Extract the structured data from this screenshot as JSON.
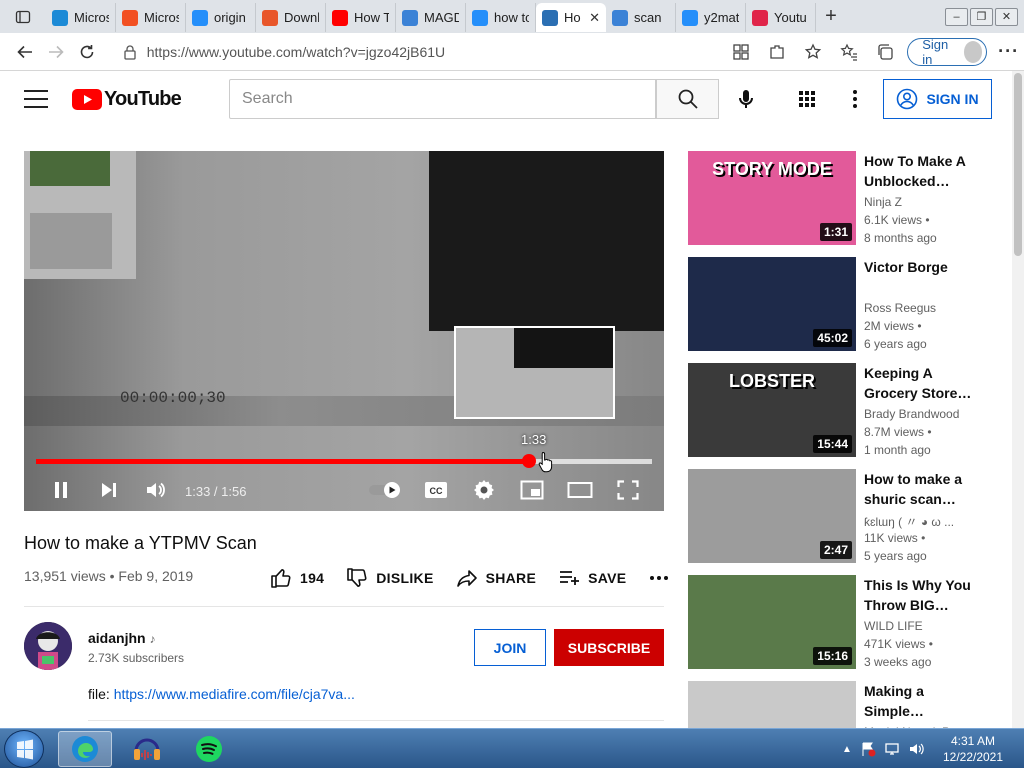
{
  "browser": {
    "tabs": [
      {
        "title": "Micros",
        "icon": "edge-icon",
        "color": "#1c8ad6"
      },
      {
        "title": "Micros",
        "icon": "microsoft-icon",
        "color": "#f25022"
      },
      {
        "title": "origin",
        "icon": "bing-icon",
        "color": "#258ffa"
      },
      {
        "title": "Downl",
        "icon": "download-site-icon",
        "color": "#e8562a"
      },
      {
        "title": "How T",
        "icon": "youtube-icon",
        "color": "#ff0000"
      },
      {
        "title": "MAGD",
        "icon": "swirl-icon",
        "color": "#3b82d6"
      },
      {
        "title": "how to",
        "icon": "bing-icon",
        "color": "#258ffa"
      },
      {
        "title": "Ho",
        "icon": "audio-icon",
        "color": "#2b6fb3",
        "active": true
      },
      {
        "title": "scan",
        "icon": "swirl-icon",
        "color": "#3b82d6"
      },
      {
        "title": "y2mat",
        "icon": "bing-icon",
        "color": "#258ffa"
      },
      {
        "title": "Youtu",
        "icon": "download-icon",
        "color": "#e0254a"
      }
    ],
    "url": "https://www.youtube.com/watch?v=jgzo42jB61U",
    "sign_in_label": "Sign in"
  },
  "youtube": {
    "logo_text": "YouTube",
    "search_placeholder": "Search",
    "sign_in_label": "SIGN IN"
  },
  "player": {
    "time_current": "1:33",
    "time_total": "1:56",
    "time_display": "1:33 / 1:56",
    "preview_time": "1:33",
    "progress_fraction": 0.8,
    "buffered_fraction": 1.0,
    "overlay_timecode": "00:00:00;30"
  },
  "video": {
    "title": "How to make a YTPMV Scan",
    "views": "13,951 views",
    "date": "Feb 9, 2019",
    "meta_separator": " • ",
    "likes": "194",
    "dislike_label": "DISLIKE",
    "share_label": "SHARE",
    "save_label": "SAVE"
  },
  "channel": {
    "name": "aidanjhn",
    "note_icon": "♪",
    "subscribers": "2.73K subscribers",
    "join_label": "JOIN",
    "subscribe_label": "SUBSCRIBE"
  },
  "description": {
    "prefix": "file: ",
    "link": "https://www.mediafire.com/file/cja7va..."
  },
  "recommendations": [
    {
      "title": "How To Make A Unblocked…",
      "channel": "Ninja Z",
      "views": "6.1K views •",
      "age": "8 months ago",
      "duration": "1:31",
      "thumb_color": "#e25a9a",
      "thumb_text": "STORY MODE"
    },
    {
      "title": "Victor Borge",
      "channel": "Ross Reegus",
      "views": "2M views •",
      "age": "6 years ago",
      "duration": "45:02",
      "thumb_color": "#1e2a4a",
      "thumb_text": ""
    },
    {
      "title": "Keeping A Grocery Store…",
      "channel": "Brady Brandwood",
      "views": "8.7M views •",
      "age": "1 month ago",
      "duration": "15:44",
      "thumb_color": "#3a3a3a",
      "thumb_text": "LOBSTER"
    },
    {
      "title": "How to make a shuric scan…",
      "channel": "ƙɛƖɯŋ ( 〃 ◕ ω ...",
      "views": "11K views •",
      "age": "5 years ago",
      "duration": "2:47",
      "thumb_color": "#9c9c9c",
      "thumb_text": ""
    },
    {
      "title": "This Is Why You Throw BIG…",
      "channel": "WILD LIFE",
      "views": "471K views •",
      "age": "3 weeks ago",
      "duration": "15:16",
      "thumb_color": "#5a7a4a",
      "thumb_text": ""
    },
    {
      "title": "Making a Simple…",
      "channel": "Maciej Nowak Pr…",
      "views": "",
      "age": "",
      "duration": "",
      "thumb_color": "#c9c9c9",
      "thumb_text": ""
    }
  ],
  "taskbar": {
    "apps": [
      {
        "name": "edge",
        "active": true,
        "color": "#1c8ad6"
      },
      {
        "name": "audacity",
        "active": false,
        "color": "#f2a33a"
      },
      {
        "name": "spotify",
        "active": false,
        "color": "#1ed760"
      }
    ],
    "time": "4:31 AM",
    "date": "12/22/2021"
  }
}
